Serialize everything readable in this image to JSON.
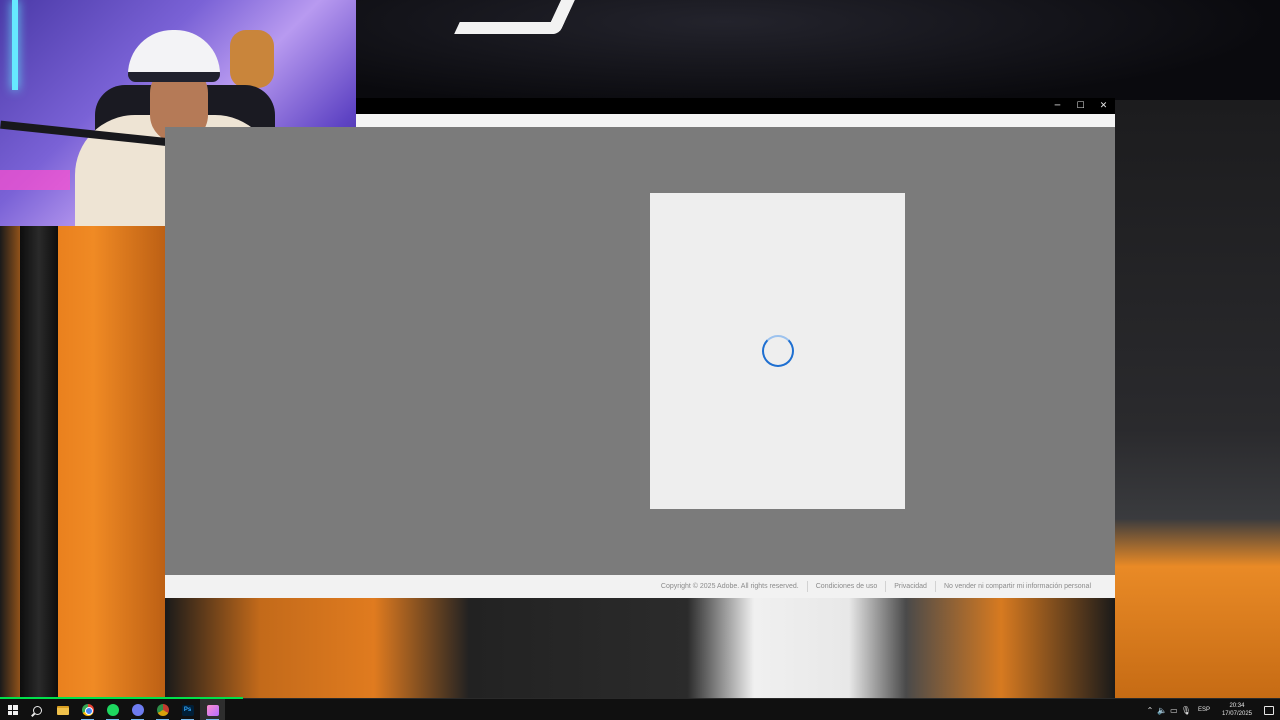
{
  "window": {
    "controls": {
      "minimize": "─",
      "maximize": "☐",
      "close": "✕"
    },
    "dialog_state": "loading",
    "footer": {
      "copyright": "Copyright © 2025 Adobe. All rights reserved.",
      "links": [
        "Condiciones de uso",
        "Privacidad",
        "No vender ni compartir mi información personal"
      ]
    }
  },
  "taskbar": {
    "apps": [
      "start-icon",
      "search-icon",
      "file-explorer-icon",
      "chrome-icon",
      "spotify-icon",
      "discord-icon",
      "chrome-alt-icon",
      "photoshop-icon",
      "app-icon"
    ],
    "photoshop_label": "Ps",
    "tray": {
      "chevron": "⌃",
      "volume": "🔈",
      "network": "▭",
      "mic": "🎙",
      "language": "ESP"
    },
    "time": "20:34",
    "date": "17/07/2025",
    "video_progress": 0.19
  },
  "colors": {
    "accent": "#1e6fd1",
    "progress": "#00e04b",
    "window_bg": "#7b7b7b"
  }
}
